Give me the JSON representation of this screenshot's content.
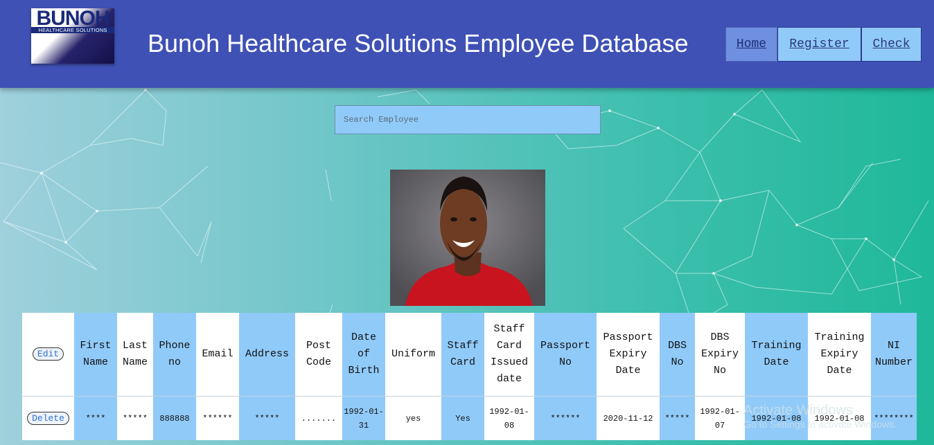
{
  "header": {
    "logo_text": "BUNOH",
    "logo_subtext": "HEALTHCARE SOLUTIONS",
    "title": "Bunoh Healthcare Solutions Employee Database",
    "nav": [
      {
        "label": "Home",
        "active": true
      },
      {
        "label": "Register",
        "active": false
      },
      {
        "label": "Check",
        "active": false
      }
    ]
  },
  "search": {
    "placeholder": "Search Employee",
    "value": ""
  },
  "profile": {
    "photo": "smiling-man-red-sweater-photo"
  },
  "table": {
    "action_top": "Edit",
    "action_bottom": "Delete",
    "columns": [
      "First Name",
      "Last Name",
      "Phone no",
      "Email",
      "Address",
      "Post Code",
      "Date of Birth",
      "Uniform",
      "Staff Card",
      "Staff Card Issued date",
      "Passport No",
      "Passport Expiry Date",
      "DBS No",
      "DBS Expiry No",
      "Training Date",
      "Training Expiry Date",
      "NI Number"
    ],
    "row": [
      "****",
      "*****",
      "888888",
      "******",
      "*****",
      ".......",
      "1992-01-31",
      "yes",
      "Yes",
      "1992-01-08",
      "******",
      "2020-11-12",
      "*****",
      "1992-01-07",
      "1992-01-08",
      "1992-01-08",
      "********"
    ]
  },
  "watermark": {
    "line1": "Activate Windows",
    "line2": "Go to Settings to activate Windows."
  },
  "colors": {
    "header": "#3f51b5",
    "nav_button": "#90caf9",
    "nav_active": "#6f8fe0",
    "column_accent": "#90caf9",
    "link": "#2d6fd0"
  }
}
